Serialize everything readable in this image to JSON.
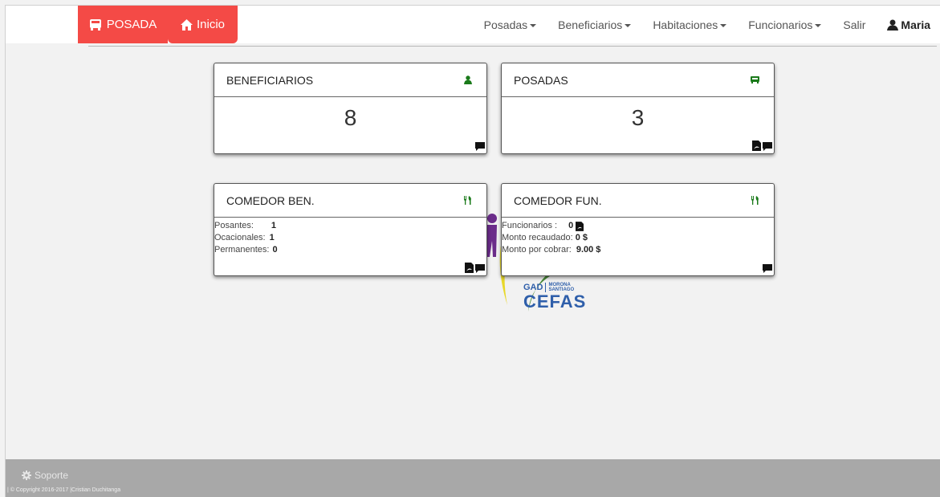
{
  "navbar": {
    "brand_label": "POSADA",
    "home_label": "Inicio",
    "menu": [
      {
        "label": "Posadas"
      },
      {
        "label": "Beneficiarios"
      },
      {
        "label": "Habitaciones"
      },
      {
        "label": "Funcionarios"
      }
    ],
    "logout_label": "Salir",
    "user_name": "Maria"
  },
  "logo": {
    "gad": "GAD",
    "morona": "MORONA",
    "santiago": "SANTIAGO",
    "cefas": "CEFAS"
  },
  "panels": {
    "beneficiarios": {
      "title": "BENEFICIARIOS",
      "value": "8"
    },
    "posadas": {
      "title": "POSADAS",
      "value": "3"
    },
    "comedor_ben": {
      "title": "COMEDOR BEN.",
      "rows": [
        {
          "label": "Posantes:",
          "value": "1"
        },
        {
          "label": "Ocacionales:",
          "value": "1"
        },
        {
          "label": "Permanentes:",
          "value": "0"
        }
      ]
    },
    "comedor_fun": {
      "title": "COMEDOR FUN.",
      "rows": [
        {
          "label": "Funcionarios :",
          "value": "0"
        },
        {
          "label": "Monto recaudado:",
          "value": "0 $"
        },
        {
          "label": "Monto por cobrar:",
          "value": "9.00 $"
        }
      ]
    }
  },
  "footer": {
    "support_label": "Soporte",
    "copyright": "| © Copyright 2016-2017 |Cristian Duchitanga"
  },
  "colors": {
    "brand_red": "#f44a46",
    "icon_green": "#1a7a1a",
    "footer_gray": "#a8a8a8"
  }
}
